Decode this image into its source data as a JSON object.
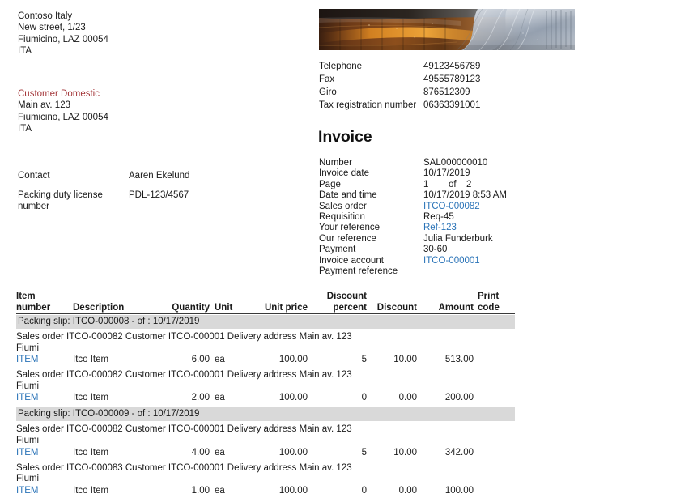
{
  "sender": {
    "lines": [
      "Contoso Italy",
      "New street, 1/23",
      "Fiumicino, LAZ 00054",
      "ITA"
    ]
  },
  "customer": {
    "name": "Customer Domestic",
    "lines": [
      "Main av. 123",
      "Fiumicino, LAZ 00054",
      "ITA"
    ]
  },
  "contact": {
    "label": "Contact",
    "value": "Aaren Ekelund"
  },
  "packing_license": {
    "label_line1": "Packing duty license",
    "label_line2": "number",
    "value": "PDL-123/4567"
  },
  "company_contact": [
    {
      "label": "Telephone",
      "value": "49123456789"
    },
    {
      "label": "Fax",
      "value": "49555789123"
    },
    {
      "label": "Giro",
      "value": "876512309"
    },
    {
      "label": "Tax registration number",
      "value": "06363391001"
    }
  ],
  "invoice": {
    "title": "Invoice",
    "number_label": "Number",
    "number_value": "SAL000000010",
    "date_label": "Invoice date",
    "date_value": "10/17/2019",
    "page_label": "Page",
    "page_current": "1",
    "page_of": "of",
    "page_total": "2",
    "datetime_label": "Date and time",
    "datetime_value": "10/17/2019 8:53 AM",
    "sales_order_label": "Sales order",
    "sales_order_value": "ITCO-000082",
    "requisition_label": "Requisition",
    "requisition_value": "Req-45",
    "your_ref_label": "Your reference",
    "your_ref_value": "Ref-123",
    "our_ref_label": "Our reference",
    "our_ref_value": "Julia Funderburk",
    "payment_label": "Payment",
    "payment_value": "30-60",
    "account_label": "Invoice account",
    "account_value": "ITCO-000001",
    "payment_ref_label": "Payment reference",
    "payment_ref_value": ""
  },
  "table": {
    "headers": {
      "item_number_l1": "Item",
      "item_number_l2": "number",
      "description": "Description",
      "quantity": "Quantity",
      "unit": "Unit",
      "unit_price": "Unit price",
      "discount_percent_l1": "Discount",
      "discount_percent_l2": "percent",
      "discount": "Discount",
      "amount": "Amount",
      "print_code_l1": "Print",
      "print_code_l2": "code"
    },
    "groups": [
      {
        "band": "Packing slip: ITCO-000008 - of : 10/17/2019",
        "rows": [
          {
            "context_line1": "Sales order ITCO-000082 Customer ITCO-000001 Delivery address Main av. 123",
            "context_line2": "Fiumi",
            "item_number": "ITEM",
            "description": "Itco Item",
            "quantity": "6.00",
            "unit": "ea",
            "unit_price": "100.00",
            "discount_percent": "5",
            "discount": "10.00",
            "amount": "513.00",
            "print_code": ""
          },
          {
            "context_line1": "Sales order ITCO-000082 Customer ITCO-000001 Delivery address Main av. 123",
            "context_line2": "Fiumi",
            "item_number": "ITEM",
            "description": "Itco Item",
            "quantity": "2.00",
            "unit": "ea",
            "unit_price": "100.00",
            "discount_percent": "0",
            "discount": "0.00",
            "amount": "200.00",
            "print_code": ""
          }
        ]
      },
      {
        "band": "Packing slip: ITCO-000009 - of : 10/17/2019",
        "rows": [
          {
            "context_line1": "Sales order ITCO-000082 Customer ITCO-000001 Delivery address Main av. 123",
            "context_line2": "Fiumi",
            "item_number": "ITEM",
            "description": "Itco Item",
            "quantity": "4.00",
            "unit": "ea",
            "unit_price": "100.00",
            "discount_percent": "5",
            "discount": "10.00",
            "amount": "342.00",
            "print_code": ""
          },
          {
            "context_line1": "Sales order ITCO-000083 Customer ITCO-000001 Delivery address Main av. 123",
            "context_line2": "Fiumi",
            "item_number": "ITEM",
            "description": "Itco Item",
            "quantity": "1.00",
            "unit": "ea",
            "unit_price": "100.00",
            "discount_percent": "0",
            "discount": "0.00",
            "amount": "100.00",
            "print_code": ""
          }
        ]
      }
    ]
  },
  "colors": {
    "customer_name": "#a4373a",
    "link": "#2b74b8",
    "band": "#d9d9d9",
    "text": "#1a1a1a"
  },
  "banner": {
    "alt": "metallic-architecture-banner"
  }
}
